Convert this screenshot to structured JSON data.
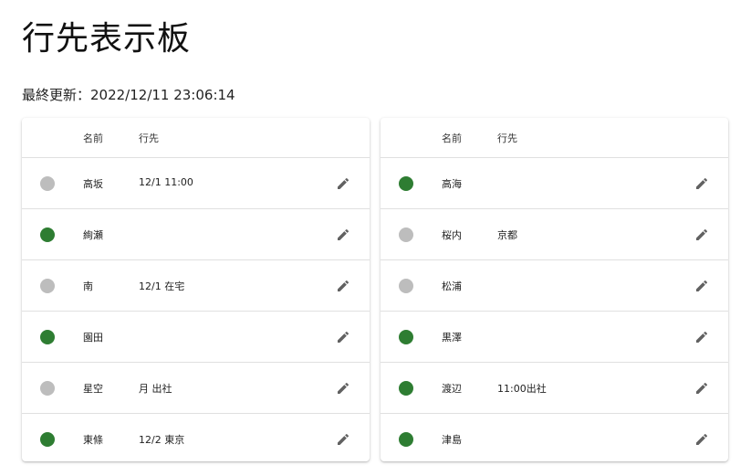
{
  "page": {
    "title": "行先表示板",
    "last_updated": "最終更新：2022/12/11 23:06:14"
  },
  "colors": {
    "in_office": "#2e7d32",
    "away": "#bdbdbd"
  },
  "tables": [
    {
      "headers": {
        "name": "名前",
        "destination": "行先"
      },
      "rows": [
        {
          "status": "away",
          "name": "高坂",
          "destination": "12/1 11:00",
          "action_icon": "pencil-icon"
        },
        {
          "status": "in_office",
          "name": "絢瀬",
          "destination": "",
          "action_icon": "pencil-icon"
        },
        {
          "status": "away",
          "name": "南",
          "destination": "12/1 在宅",
          "action_icon": "pencil-icon"
        },
        {
          "status": "in_office",
          "name": "園田",
          "destination": "",
          "action_icon": "pencil-icon"
        },
        {
          "status": "away",
          "name": "星空",
          "destination": "月 出社",
          "action_icon": "pencil-icon"
        },
        {
          "status": "in_office",
          "name": "東條",
          "destination": "12/2 東京",
          "action_icon": "pencil-icon"
        }
      ]
    },
    {
      "headers": {
        "name": "名前",
        "destination": "行先"
      },
      "rows": [
        {
          "status": "in_office",
          "name": "高海",
          "destination": "",
          "action_icon": "pencil-icon"
        },
        {
          "status": "away",
          "name": "桜内",
          "destination": "京都",
          "action_icon": "pencil-icon"
        },
        {
          "status": "away",
          "name": "松浦",
          "destination": "",
          "action_icon": "pencil-icon"
        },
        {
          "status": "in_office",
          "name": "黒澤",
          "destination": "",
          "action_icon": "pencil-icon"
        },
        {
          "status": "in_office",
          "name": "渡辺",
          "destination": "11:00出社",
          "action_icon": "pencil-icon"
        },
        {
          "status": "in_office",
          "name": "津島",
          "destination": "",
          "action_icon": "pencil-icon"
        }
      ]
    }
  ]
}
